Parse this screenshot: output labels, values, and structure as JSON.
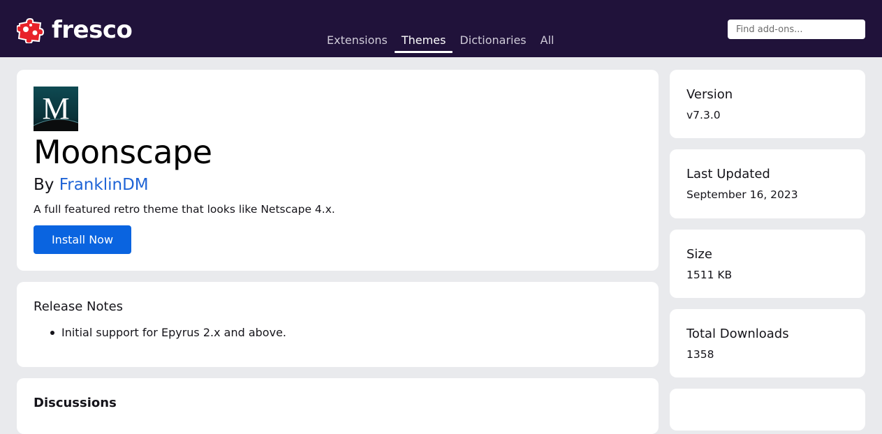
{
  "header": {
    "logo_text": "fresco",
    "nav": [
      {
        "label": "Extensions",
        "active": false
      },
      {
        "label": "Themes",
        "active": true
      },
      {
        "label": "Dictionaries",
        "active": false
      },
      {
        "label": "All",
        "active": false
      }
    ],
    "search": {
      "placeholder": "Find add-ons...",
      "value": ""
    }
  },
  "addon": {
    "icon_letter": "M",
    "title": "Moonscape",
    "by_prefix": "By",
    "author": "FranklinDM",
    "summary": "A full featured retro theme that looks like Netscape 4.x.",
    "install_label": "Install Now"
  },
  "release_notes": {
    "title": "Release Notes",
    "items": [
      "Initial support for Epyrus 2.x and above."
    ]
  },
  "discussions": {
    "title": "Discussions"
  },
  "sidebar": [
    {
      "label": "Version",
      "value": "v7.3.0"
    },
    {
      "label": "Last Updated",
      "value": "September 16, 2023"
    },
    {
      "label": "Size",
      "value": "1511 KB"
    },
    {
      "label": "Total Downloads",
      "value": "1358"
    },
    {
      "label": "",
      "value": ""
    }
  ],
  "colors": {
    "header_bg": "#20123a",
    "page_bg": "#e9eaed",
    "accent": "#0a64e0",
    "link": "#1f64d6",
    "logo_red": "#e8222a"
  }
}
